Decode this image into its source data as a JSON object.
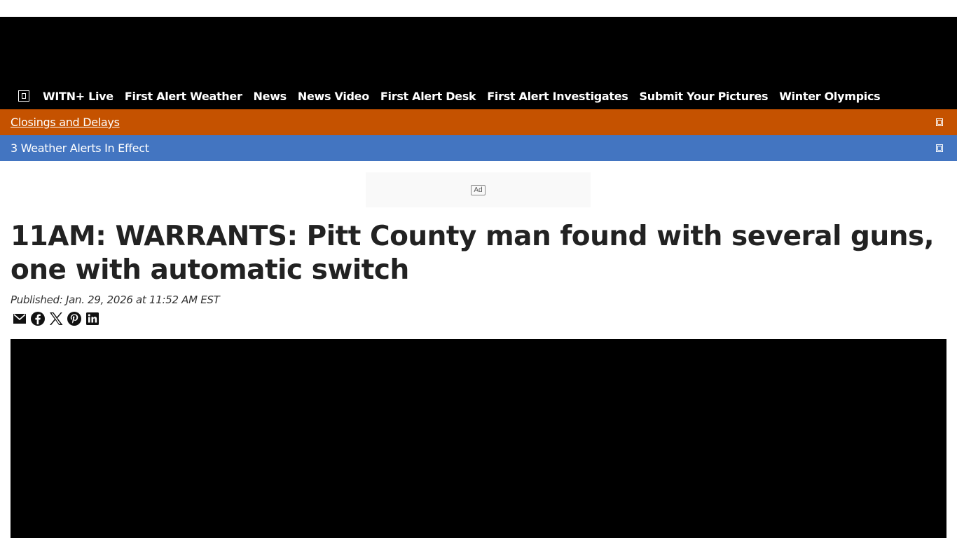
{
  "nav": {
    "menu_icon": "menu-icon",
    "items": [
      {
        "label": "WITN+ Live"
      },
      {
        "label": "First Alert Weather"
      },
      {
        "label": "News"
      },
      {
        "label": "News Video"
      },
      {
        "label": "First Alert Desk"
      },
      {
        "label": "First Alert Investigates"
      },
      {
        "label": "Submit Your Pictures"
      },
      {
        "label": "Winter Olympics"
      }
    ]
  },
  "alerts": {
    "closings": {
      "label": "Closings and Delays",
      "color": "#c55200"
    },
    "weather": {
      "label": "3 Weather Alerts In Effect",
      "color": "#4375c1"
    }
  },
  "ad": {
    "label": "Ad"
  },
  "article": {
    "headline": "11AM: WARRANTS: Pitt County man found with several guns, one with automatic switch",
    "published": "Published: Jan. 29, 2026 at 11:52 AM EST"
  },
  "share": [
    "email-icon",
    "facebook-icon",
    "x-icon",
    "pinterest-icon",
    "linkedin-icon"
  ]
}
